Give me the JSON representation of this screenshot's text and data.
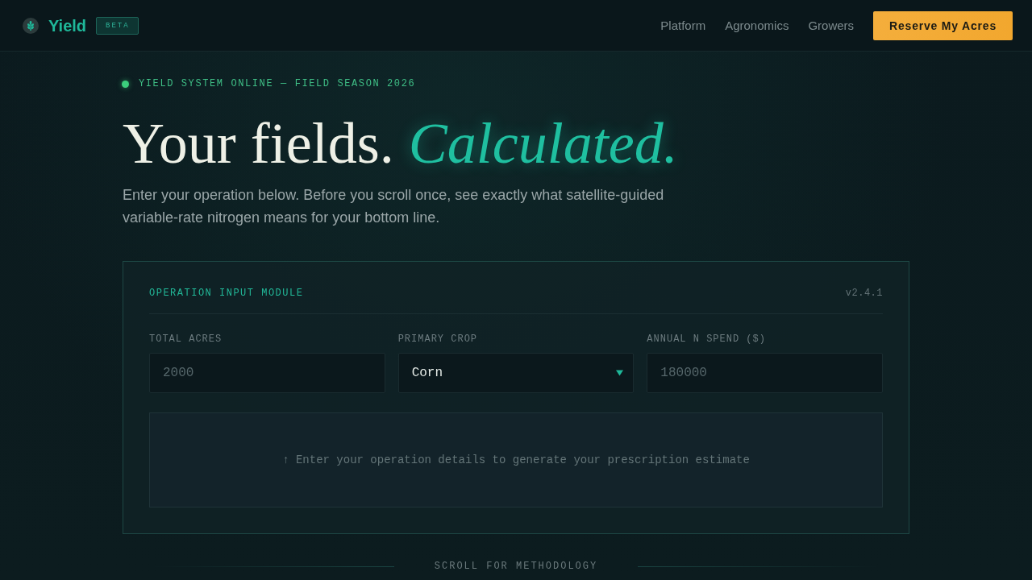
{
  "header": {
    "brand": "Yield",
    "badge": "BETA",
    "nav": [
      {
        "label": "Platform"
      },
      {
        "label": "Agronomics"
      },
      {
        "label": "Growers"
      }
    ],
    "cta": "Reserve My Acres"
  },
  "hero": {
    "status": {
      "text": "YIELD SYSTEM ONLINE — FIELD SEASON 2026",
      "online": true
    },
    "headline": {
      "lead": "Your fields.",
      "accent": "Calculated."
    },
    "subtitle": "Enter your operation below. Before you scroll once, see exactly what satellite-guided variable-rate nitrogen means for your bottom line."
  },
  "module": {
    "title": "OPERATION INPUT MODULE",
    "version": "v2.4.1",
    "fields": [
      {
        "kind": "number",
        "label": "TOTAL ACRES",
        "placeholder": "2000"
      },
      {
        "kind": "select",
        "label": "PRIMARY CROP",
        "value": "Corn"
      },
      {
        "kind": "number",
        "label": "ANNUAL N SPEND ($)",
        "placeholder": "180000"
      }
    ],
    "result_hint": "↑ Enter your operation details to generate your prescription estimate"
  },
  "scroll_hint": "SCROLL FOR METHODOLOGY"
}
